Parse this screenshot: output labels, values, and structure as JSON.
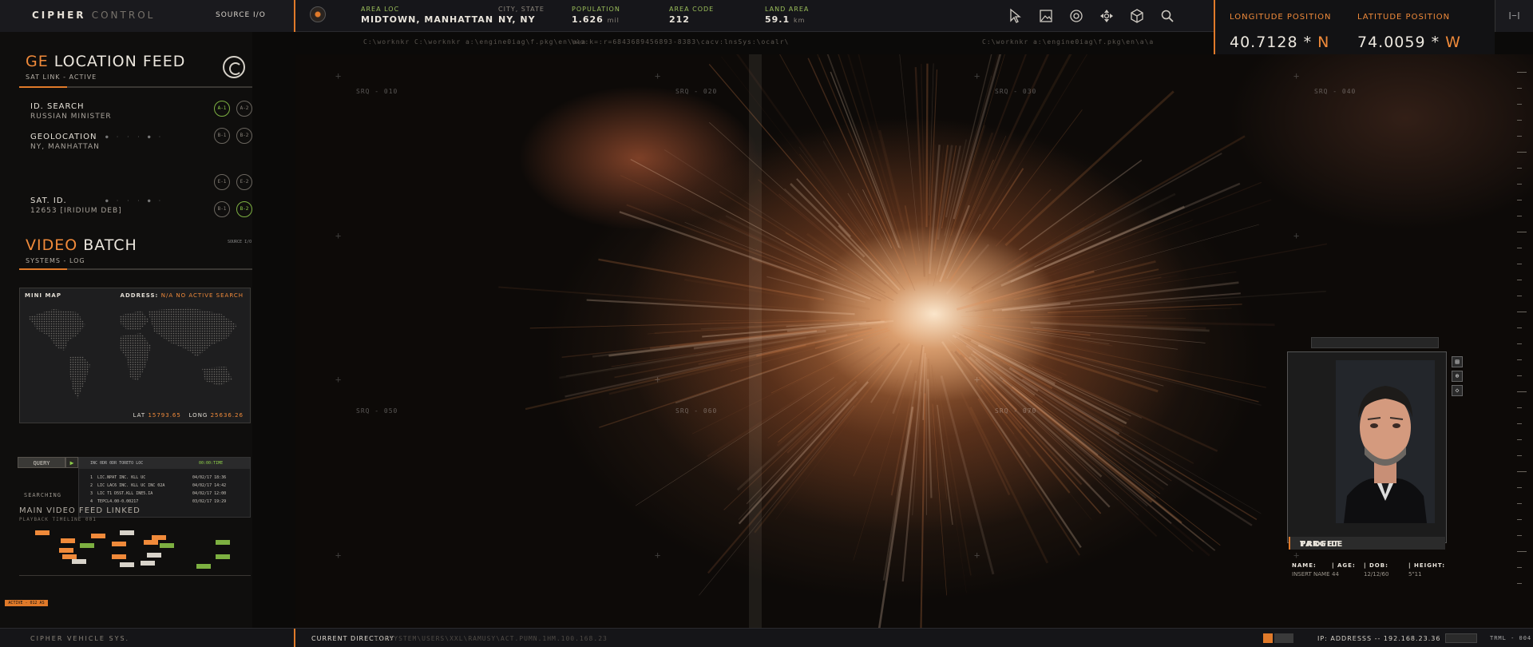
{
  "app": {
    "title_main": "CIPHER",
    "title_dim": "CONTROL",
    "source_label": "SOURCE I/O"
  },
  "stats": {
    "area_loc": {
      "label": "AREA LOC",
      "value": "MIDTOWN, MANHATTAN"
    },
    "city_state": {
      "label": "CITY, STATE",
      "value": "NY, NY"
    },
    "population": {
      "label": "POPULATION",
      "value": "1.626",
      "unit": "mil"
    },
    "area_code": {
      "label": "AREA CODE",
      "value": "212"
    },
    "land_area": {
      "label": "LAND AREA",
      "value": "59.1",
      "unit": "km"
    },
    "path_left": "C:\\worknkr  C:\\worknkr  a:\\engine0iag\\f.pkg\\en\\a\\a",
    "path_mid": "\\wo:k=:r=6843689456893-8383\\cacv:lnsSys:\\ocalr\\",
    "path_right": "C:\\worknkr  a:\\engine0iag\\f.pkg\\en\\a\\a"
  },
  "tools": [
    {
      "name": "pointer-icon"
    },
    {
      "name": "image-icon"
    },
    {
      "name": "target-icon"
    },
    {
      "name": "move-icon"
    },
    {
      "name": "cube-icon"
    },
    {
      "name": "search-icon"
    }
  ],
  "coords": {
    "longitude_label": "LONGITUDE POSITION",
    "longitude_value": "40.7128 *",
    "longitude_dir": "N",
    "latitude_label": "LATITUDE POSITION",
    "latitude_value": "74.0059 *",
    "latitude_dir": "W",
    "corner": "|–|"
  },
  "geo": {
    "title_accent": "GE",
    "title_rest": " LOCATION FEED",
    "subtitle": "SAT LINK - ACTIVE",
    "fields": [
      {
        "label": "ID. SEARCH",
        "value": "RUSSIAN MINISTER"
      },
      {
        "label": "GEOLOCATION",
        "value": "NY, MANHATTAN"
      },
      {
        "label": "SAT. ID.",
        "value": "12653 [IRIDIUM DEB]"
      }
    ],
    "pills": [
      "A-1",
      "A-2",
      "B-1",
      "B-2",
      "E-1",
      "E-2",
      "B-1",
      "B-2"
    ]
  },
  "video": {
    "title_accent": "VIDEO",
    "title_rest": " BATCH",
    "subtitle": "SYSTEMS - LOG",
    "source_mini": "SOURCE I/O"
  },
  "minimap": {
    "label": "MINI MAP",
    "address_label": "ADDRESS:",
    "address_value": "N/A NO ACTIVE SEARCH",
    "lat_label": "LAT",
    "lat_value": "15793.65",
    "long_label": "LONG",
    "long_value": "25636.26"
  },
  "search": {
    "query_label": "QUERY",
    "searching_label": "SEARCHING",
    "header_left": "INC 0DR 0DR TORETO LOC",
    "header_right": "00:00:TIME",
    "rows": [
      {
        "n": "1",
        "text": "LIC.NPAT INC. KLL UC",
        "date": "04/02/17  18:36"
      },
      {
        "n": "2",
        "text": "LIC LAC6 INC. KLL UC INC 02A",
        "date": "04/02/17  14:42"
      },
      {
        "n": "3",
        "text": "LIC T1 D5ST.KLL INE5.IA",
        "date": "04/02/17  12:00"
      },
      {
        "n": "4",
        "text": "TEPCL4.00-0.00217",
        "date": "03/02/17  19:29"
      }
    ]
  },
  "feed": {
    "title": "MAIN VIDEO FEED LINKED",
    "subtitle": "PLAYBACK TIMELINE 001",
    "alert": "ACTIVE - 012 AS"
  },
  "viewport": {
    "grid_labels": [
      "SRQ - 010",
      "SRQ - 020",
      "SRQ - 030",
      "SRQ - 040",
      "SRQ - 050",
      "SRQ - 060",
      "SRQ - 070"
    ]
  },
  "target": {
    "title_accent": "TARGET",
    "title_rest": " PROFILE",
    "name_label": "NAME:",
    "name_value": "INSERT NAME",
    "age_label": "| AGE:",
    "age_value": "44",
    "dob_label": "| DOB:",
    "dob_value": "12/12/60",
    "height_label": "| HEIGHT:",
    "height_value": "5\"11"
  },
  "bottom": {
    "left_label": "CIPHER VEHICLE SYS.",
    "dir_label": "CURRENT DIRECTORY",
    "dir_path": "C:\\SYSTEM\\USERS\\XXL\\RAMUSY\\ACT.PUMN.1HM.100.168.23",
    "ip_label": "IP: ADDRESSS -- 192.168.23.36",
    "term": "TRML - 004"
  }
}
